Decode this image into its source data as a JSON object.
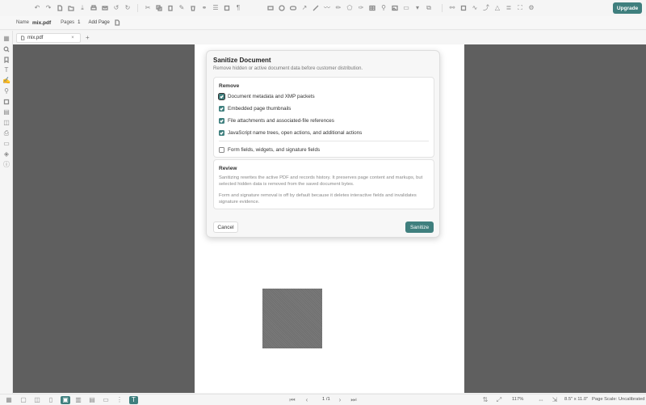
{
  "toolbar": {
    "upgrade_label": "Upgrade",
    "left_icons": [
      "undo-icon",
      "redo-icon",
      "new-file-icon",
      "open-folder-icon",
      "download-icon",
      "print-icon",
      "mail-icon",
      "rotate-left-icon",
      "rotate-right-icon"
    ],
    "edit_icons": [
      "cut-icon",
      "copy-icon",
      "paste-icon",
      "magic-icon",
      "delete-icon",
      "link-icon",
      "stack-icon",
      "crop-icon",
      "text-format-icon"
    ],
    "shape_icons": [
      "rectangle-icon",
      "ellipse-icon",
      "rounded-rect-icon",
      "arrow-icon",
      "line-icon",
      "freehand-icon",
      "pencil-icon",
      "highlighter-icon",
      "polygon-icon",
      "table-icon",
      "stamp-icon",
      "image-icon",
      "more-icon"
    ],
    "right_icons": [
      "chain-icon",
      "square-icon",
      "signature-icon",
      "curve-icon",
      "bell-icon",
      "layers-icon",
      "fullscreen-icon",
      "settings-icon"
    ]
  },
  "infobar": {
    "name_label": "Name",
    "name_value": "mix.pdf",
    "pages_label": "Pages",
    "pages_value": "1",
    "add_page_label": "Add Page"
  },
  "tabs": [
    {
      "label": "mix.pdf"
    }
  ],
  "sidebar": {
    "icons": [
      "thumbnails-icon",
      "search-icon",
      "bookmark-icon",
      "text-icon",
      "signature-icon",
      "attachment-icon",
      "crop-icon",
      "archive-icon",
      "stack-icon",
      "print-icon",
      "form-icon",
      "layers-icon",
      "info-icon"
    ]
  },
  "dialog": {
    "title": "Sanitize Document",
    "subtitle": "Remove hidden or active document data before customer distribution.",
    "remove_heading": "Remove",
    "options": [
      {
        "label": "Document metadata and XMP packets",
        "checked": true
      },
      {
        "label": "Embedded page thumbnails",
        "checked": true
      },
      {
        "label": "File attachments and associated-file references",
        "checked": true
      },
      {
        "label": "JavaScript name trees, open actions, and additional actions",
        "checked": true
      },
      {
        "label": "Form fields, widgets, and signature fields",
        "checked": false
      }
    ],
    "review_heading": "Review",
    "review_p1": "Sanitizing rewrites the active PDF and records history. It preserves page content and markups, but selected hidden data is removed from the saved document bytes.",
    "review_p2": "Form and signature removal is off by default because it deletes interactive fields and invalidates signature evidence.",
    "cancel_label": "Cancel",
    "sanitize_label": "Sanitize"
  },
  "bottombar": {
    "page_display": "1 /1",
    "zoom": "117%",
    "page_size": "8.5\" x 11.0\"",
    "page_scale": "Page Scale: Uncalibrated"
  },
  "colors": {
    "accent": "#3f7f7e",
    "canvas": "#5f5f5f"
  }
}
